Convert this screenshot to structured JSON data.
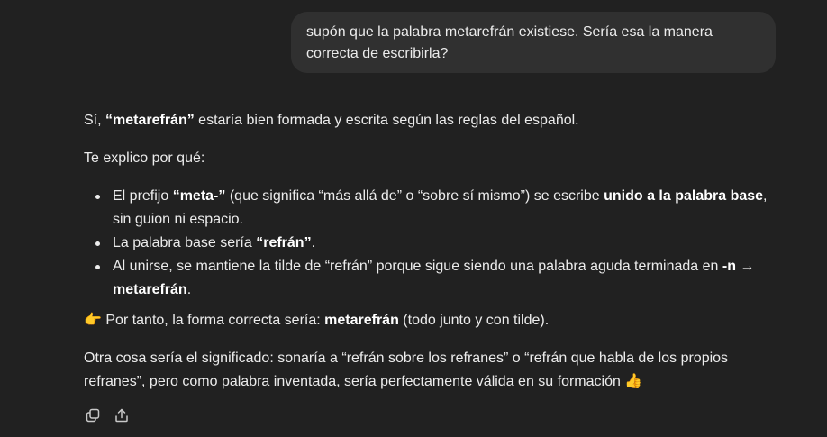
{
  "user_message": {
    "line1": "supón que la palabra metarefrán existiese. Sería esa la manera",
    "line2": "correcta de escribirla?"
  },
  "assistant": {
    "p1": {
      "a": "Sí, ",
      "b": "“metarefrán”",
      "c": " estaría bien formada y escrita según las reglas del español."
    },
    "p2": "Te explico por qué:",
    "bullets": [
      {
        "a": "El prefijo ",
        "b": "“meta-”",
        "c": " (que significa “más allá de” o “sobre sí mismo”) se escribe ",
        "d": "unido a la palabra base",
        "e": ", sin guion ni espacio."
      },
      {
        "a": "La palabra base sería ",
        "b": "“refrán”",
        "c": "."
      },
      {
        "a": "Al unirse, se mantiene la tilde de “refrán” porque sigue siendo una palabra aguda terminada en ",
        "b": "-n",
        "c": " → ",
        "d": "metarefrán",
        "e": "."
      }
    ],
    "p3": {
      "a": "👉 Por tanto, la forma correcta sería: ",
      "b": "metarefrán",
      "c": " (todo junto y con tilde)."
    },
    "p4": "Otra cosa sería el significado: sonaría a “refrán sobre los refranes” o “refrán que habla de los propios refranes”, pero como palabra inventada, sería perfectamente válida en su formación 👍"
  },
  "actions": {
    "icons": [
      "copy-icon",
      "share-icon"
    ]
  },
  "colors": {
    "background": "#212121",
    "bubble": "#303030",
    "text": "#ececec"
  }
}
